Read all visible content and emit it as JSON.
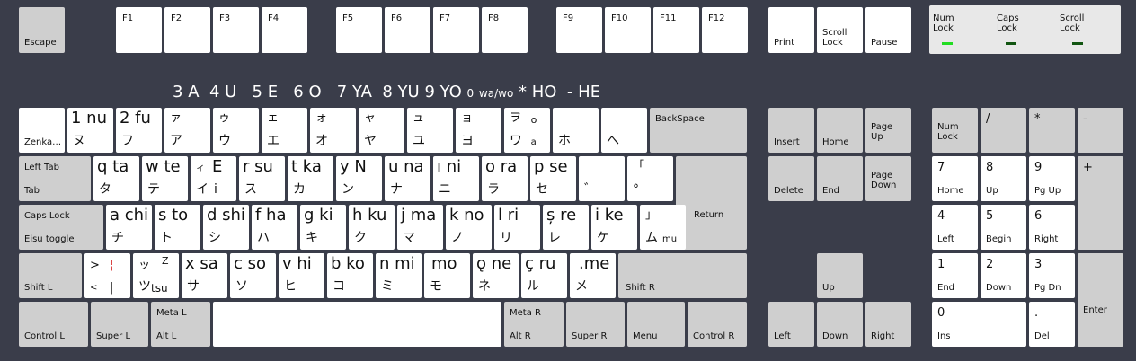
{
  "fkeys": {
    "escape": "Escape",
    "f1": "F1",
    "f2": "F2",
    "f3": "F3",
    "f4": "F4",
    "f5": "F5",
    "f6": "F6",
    "f7": "F7",
    "f8": "F8",
    "f9": "F9",
    "f10": "F10",
    "f11": "F11",
    "f12": "F12",
    "print": "Print",
    "scroll_lock_1": "Scroll",
    "scroll_lock_2": "Lock",
    "pause": "Pause"
  },
  "leds": {
    "num_1": "Num",
    "num_2": "Lock",
    "caps_1": "Caps",
    "caps_2": "Lock",
    "scroll_1": "Scroll",
    "scroll_2": "Lock",
    "num_color": "#22dd22",
    "caps_color": "#115511",
    "scroll_color": "#115511"
  },
  "number_labels": {
    "n3": "3",
    "a": "A",
    "n4": "4",
    "u": "U",
    "n5": "5",
    "e": "E",
    "n6": "6",
    "o": "O",
    "n7": "7",
    "ya": "YA",
    "n8": "8",
    "yu": "YU",
    "n9": "9",
    "yo": "YO",
    "n0": "0",
    "wawo": "wa/wo",
    "star": "*",
    "ho": "HO",
    "dash": "-",
    "he": "HE"
  },
  "row_num": {
    "zenkaku": "Zenka…",
    "k1_lat": "1 nu",
    "k1_kana": "ヌ",
    "k2_lat": "2 fu",
    "k2_kana": "フ",
    "k3_top": "ァ",
    "k3_kana": "ア",
    "k4_top": "ゥ",
    "k4_kana": "ウ",
    "k5_top": "ェ",
    "k5_kana": "エ",
    "k6_top": "ォ",
    "k6_kana": "オ",
    "k7_top": "ャ",
    "k7_kana": "ヤ",
    "k8_top": "ュ",
    "k8_kana": "ユ",
    "k9_top": "ョ",
    "k9_kana": "ヨ",
    "k0_top": "ヲ",
    "k0_small": "o",
    "k0_kana": "ワ",
    "k0_small2": "a",
    "kminus_kana": "ホ",
    "kcaret_kana": "へ",
    "backspace": "BackSpace"
  },
  "row_q": {
    "tab_top": "Left Tab",
    "tab_bot": "Tab",
    "q_lat": "q  ta",
    "q_kana": "タ",
    "w_lat": "w  te",
    "w_kana": "テ",
    "e_lat": "E",
    "e_top": "ィ",
    "e_kana": "イ",
    "e_small": "i",
    "r_lat": "r  su",
    "r_kana": "ス",
    "t_lat": "t  ka",
    "t_kana": "カ",
    "y_lat": "y  N",
    "y_kana": "ン",
    "u_lat": "u  na",
    "u_kana": "ナ",
    "i_lat": "ı  ni",
    "i_kana": "ニ",
    "o_lat": "o  ra",
    "o_kana": "ラ",
    "p_lat": "p  se",
    "p_kana": "セ",
    "at_kana": "゛",
    "br_top": "「",
    "br_kana": "°",
    "return": "Return"
  },
  "row_a": {
    "caps_top": "Caps Lock",
    "caps_bot": "Eisu toggle",
    "a_lat": "a chi",
    "a_kana": "チ",
    "s_lat": "s  to",
    "s_kana": "ト",
    "d_lat": "d shi",
    "d_kana": "シ",
    "f_lat": "f  ha",
    "f_kana": "ハ",
    "g_lat": "g  ki",
    "g_kana": "キ",
    "h_lat": "h  ku",
    "h_kana": "ク",
    "j_lat": "j  ma",
    "j_kana": "マ",
    "k_lat": "k  no",
    "k_kana": "ノ",
    "l_lat": "l    ri",
    "l_kana": "リ",
    "sc_lat": "ș  re",
    "sc_kana": "レ",
    "col_lat": "i   ke",
    "col_kana": "ケ",
    "rb_top": "」",
    "rb_kana": "ム",
    "rb_small": "mu"
  },
  "row_z": {
    "shiftl": "Shift L",
    "lt_top": ">",
    "lt_bot": "<",
    "ltk_top": "¦",
    "ltk_bot": "|",
    "tsu_top": "ッ",
    "tsu_sup": "Z",
    "tsu_kana": "ツ",
    "tsu_small": "tsu",
    "x_lat": "x  sa",
    "x_kana": "サ",
    "c_lat": "c  so",
    "c_kana": "ソ",
    "v_lat": "v  hi",
    "v_kana": "ヒ",
    "b_lat": "b  ko",
    "b_kana": "コ",
    "n_lat": "n  mi",
    "n_kana": "ミ",
    "m_lat": "mo",
    "m_kana": "モ",
    "comma_lat": "ǫ  ne",
    "comma_kana": "ネ",
    "dot_lat": "ç  ru",
    "dot_kana": "ル",
    "slash_lat": ".me",
    "slash_kana": "メ",
    "shiftr": "Shift R"
  },
  "row_bottom": {
    "controll": "Control L",
    "superl": "Super L",
    "metal": "Meta L",
    "altl": "Alt L",
    "metar": "Meta R",
    "altr": "Alt R",
    "superr": "Super R",
    "menu": "Menu",
    "controlr": "Control R"
  },
  "nav": {
    "insert": "Insert",
    "home": "Home",
    "pageup_1": "Page",
    "pageup_2": "Up",
    "delete": "Delete",
    "end": "End",
    "pagedown_1": "Page",
    "pagedown_2": "Down",
    "up": "Up",
    "left": "Left",
    "down": "Down",
    "right": "Right"
  },
  "numpad": {
    "numlock_1": "Num",
    "numlock_2": "Lock",
    "slash": "/",
    "star": "*",
    "minus": "-",
    "plus": "+",
    "n7": "7",
    "n7s": "Home",
    "n8": "8",
    "n8s": "Up",
    "n9": "9",
    "n9s": "Pg Up",
    "n4": "4",
    "n4s": "Left",
    "n5": "5",
    "n5s": "Begin",
    "n6": "6",
    "n6s": "Right",
    "n1": "1",
    "n1s": "End",
    "n2": "2",
    "n2s": "Down",
    "n3": "3",
    "n3s": "Pg Dn",
    "n0": "0",
    "n0s": "Ins",
    "dot": ".",
    "dots": "Del",
    "enter": "Enter"
  }
}
